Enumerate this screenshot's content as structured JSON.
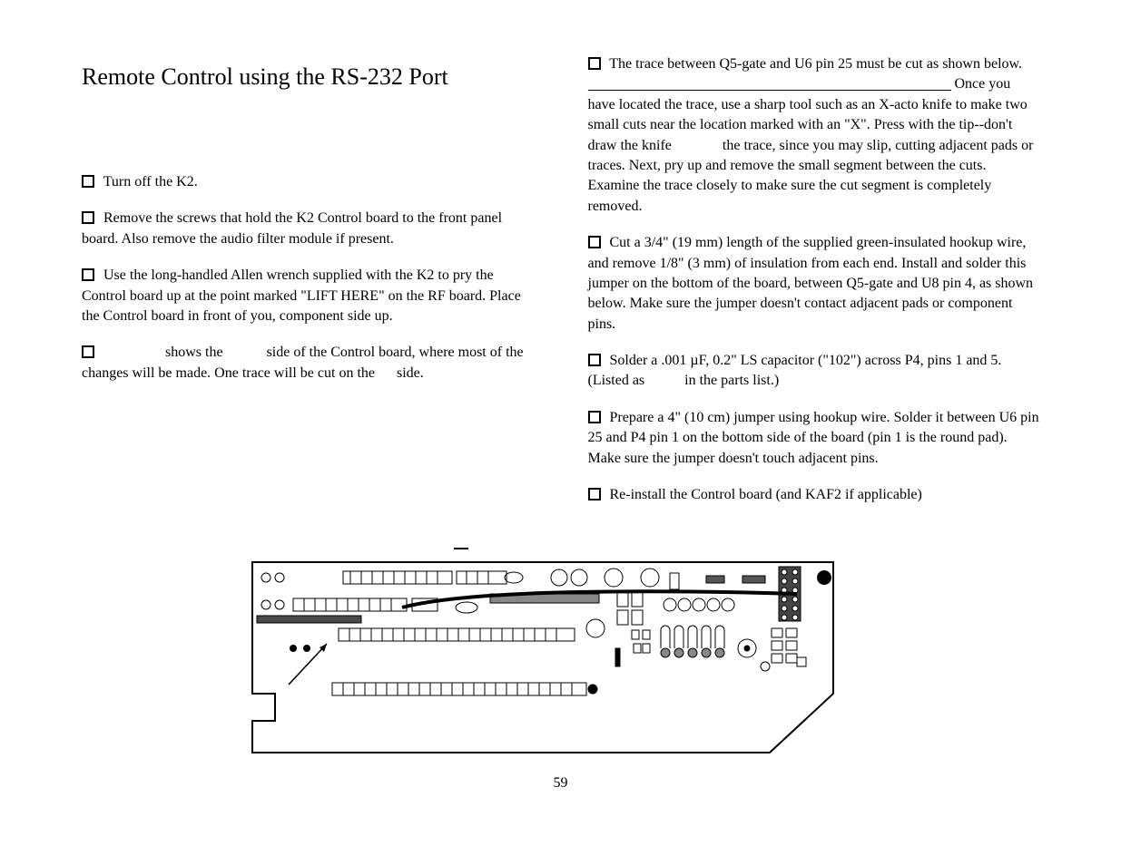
{
  "title": "Remote Control using the RS-232 Port",
  "page_number": "59",
  "left": {
    "step1": "Turn off the K2.",
    "step2": "Remove the screws that hold the K2 Control board to the front panel board. Also remove the audio filter module if present.",
    "step3": "Use the long-handled Allen wrench supplied with the K2 to pry the Control board up at the point marked \"LIFT HERE\" on the RF board. Place the Control board in front of you, component side up.",
    "step4_a": "shows the",
    "step4_b": "side of the Control board, where most of the changes will be made. One trace will be cut on the",
    "step4_c": "side."
  },
  "right": {
    "step1_a": "The trace between Q5-gate and U6 pin 25 must be cut as shown below.",
    "step1_b": "Once you have located the trace, use a sharp tool such as an X-acto knife to make two small cuts near the location marked with an \"X\". Press",
    "step1_c": "with the tip--don't draw the knife",
    "step1_d": "the trace, since you may slip, cutting adjacent pads or traces. Next, pry up and remove the small segment between the cuts. Examine the trace closely to make sure the cut segment is completely removed.",
    "step2": "Cut a 3/4\" (19 mm) length of the supplied green-insulated hookup wire, and remove 1/8\" (3 mm) of insulation from each end. Install and solder this jumper on the bottom of the board, between Q5-gate and U8 pin 4, as shown below. Make sure the jumper doesn't contact adjacent pads or component pins.",
    "step3_a": "Solder a .001 µF, 0.2\" LS capacitor (\"102\") across P4, pins 1 and 5. (Listed as",
    "step3_b": "in the parts list.)",
    "step4": "Prepare a 4\" (10 cm) jumper using hookup wire. Solder it between U6 pin 25 and P4 pin 1 on the bottom side of the board (pin 1 is the round pad). Make sure the jumper doesn't touch adjacent pins.",
    "step5": "Re-install the Control board (and KAF2 if applicable)"
  }
}
